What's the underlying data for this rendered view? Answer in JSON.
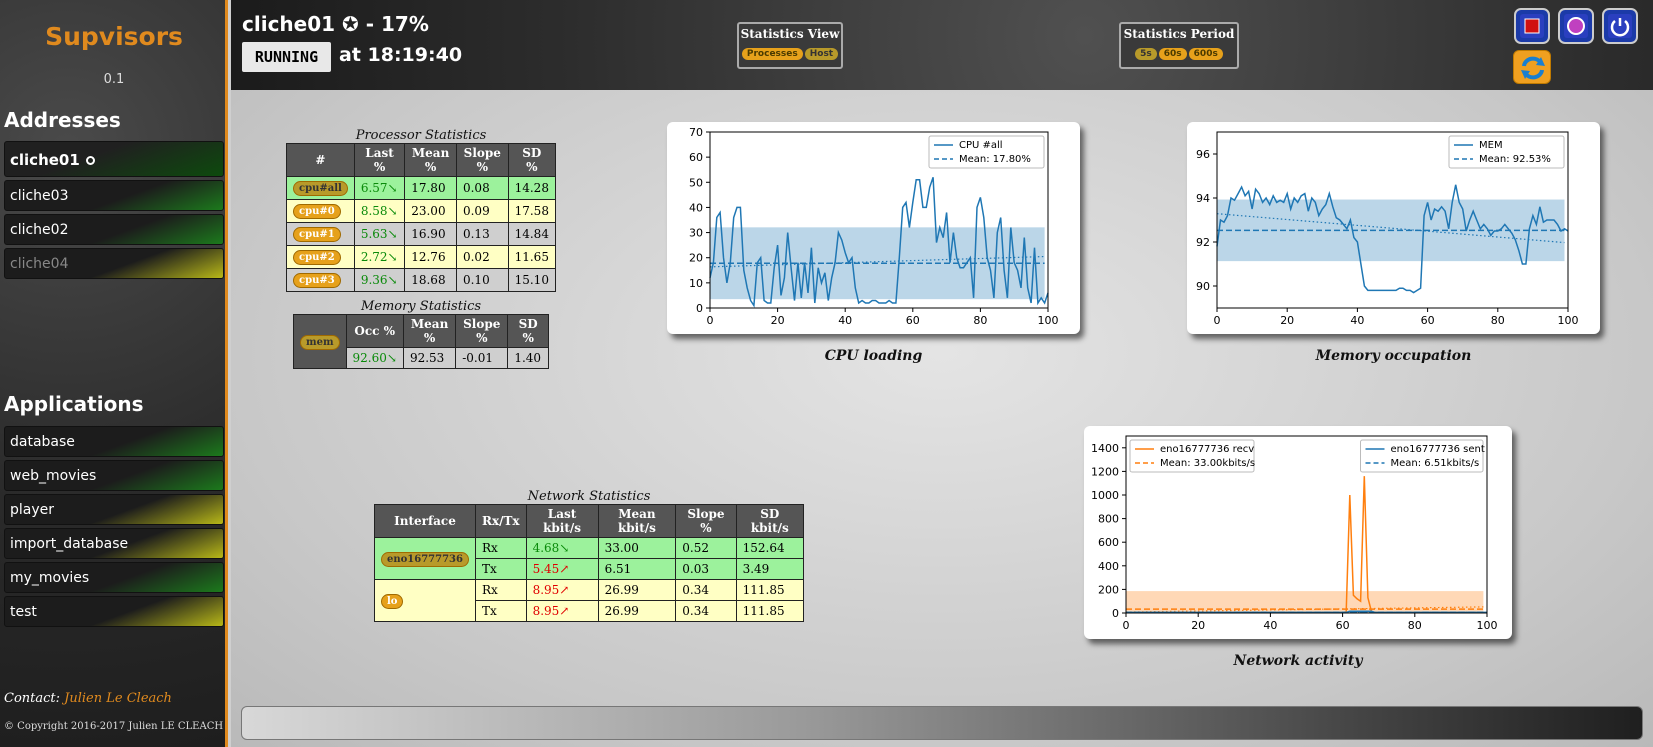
{
  "sidebar": {
    "brand": "Supvisors",
    "version": "0.1",
    "addresses_heading": "Addresses",
    "addresses": [
      {
        "label": "cliche01",
        "state": "active"
      },
      {
        "label": "cliche03",
        "state": "ok"
      },
      {
        "label": "cliche02",
        "state": "ok"
      },
      {
        "label": "cliche04",
        "state": "off"
      }
    ],
    "applications_heading": "Applications",
    "applications": [
      {
        "label": "database",
        "state": "ok"
      },
      {
        "label": "web_movies",
        "state": "ok"
      },
      {
        "label": "player",
        "state": "warn"
      },
      {
        "label": "import_database",
        "state": "warn"
      },
      {
        "label": "my_movies",
        "state": "ok"
      },
      {
        "label": "test",
        "state": "warn"
      }
    ],
    "contact_label": "Contact:",
    "contact_name": "Julien Le Cleach",
    "copyright": "© Copyright 2016-2017 Julien LE CLEACH"
  },
  "header": {
    "node_title": "cliche01 ✪ - 17%",
    "state": "RUNNING",
    "state_time": "at 18:19:40",
    "view_caption": "Statistics View",
    "view_options": [
      "Processes",
      "Host"
    ],
    "period_caption": "Statistics Period",
    "period_options": [
      "5s",
      "60s",
      "600s"
    ]
  },
  "processor": {
    "caption": "Processor Statistics",
    "headers": [
      "#",
      "Last %",
      "Mean %",
      "Slope %",
      "SD %"
    ],
    "rows": [
      {
        "cpu": "cpu#all",
        "last": "6.57↘",
        "mean": "17.80",
        "slope": "0.08",
        "sd": "14.28",
        "style": "green"
      },
      {
        "cpu": "cpu#0",
        "last": "8.58↘",
        "mean": "23.00",
        "slope": "0.09",
        "sd": "17.58",
        "style": "yellow"
      },
      {
        "cpu": "cpu#1",
        "last": "5.63↘",
        "mean": "16.90",
        "slope": "0.13",
        "sd": "14.84",
        "style": "grey"
      },
      {
        "cpu": "cpu#2",
        "last": "2.72↘",
        "mean": "12.76",
        "slope": "0.02",
        "sd": "11.65",
        "style": "yellow"
      },
      {
        "cpu": "cpu#3",
        "last": "9.36↘",
        "mean": "18.68",
        "slope": "0.10",
        "sd": "15.10",
        "style": "grey"
      }
    ]
  },
  "memory": {
    "caption": "Memory Statistics",
    "headers": [
      "Occ %",
      "Mean %",
      "Slope %",
      "SD %"
    ],
    "tag": "mem",
    "row": {
      "occ": "92.60↘",
      "mean": "92.53",
      "slope": "-0.01",
      "sd": "1.40"
    }
  },
  "network": {
    "caption": "Network Statistics",
    "headers": [
      "Interface",
      "Rx/Tx",
      "Last kbit/s",
      "Mean kbit/s",
      "Slope %",
      "SD kbit/s"
    ],
    "interfaces": [
      {
        "name": "eno16777736",
        "style": "green",
        "rows": [
          {
            "dir": "Rx",
            "last": "4.68↘",
            "last_color": "g",
            "mean": "33.00",
            "slope": "0.52",
            "sd": "152.64"
          },
          {
            "dir": "Tx",
            "last": "5.45↗",
            "last_color": "r",
            "mean": "6.51",
            "slope": "0.03",
            "sd": "3.49"
          }
        ]
      },
      {
        "name": "lo",
        "style": "yellow",
        "rows": [
          {
            "dir": "Rx",
            "last": "8.95↗",
            "last_color": "r",
            "mean": "26.99",
            "slope": "0.34",
            "sd": "111.85"
          },
          {
            "dir": "Tx",
            "last": "8.95↗",
            "last_color": "r",
            "mean": "26.99",
            "slope": "0.34",
            "sd": "111.85"
          }
        ]
      }
    ]
  },
  "chart_data": [
    {
      "type": "line",
      "title": "CPU loading",
      "x_range": [
        0,
        100
      ],
      "ylim": [
        0,
        70
      ],
      "xticks": [
        0,
        20,
        40,
        60,
        80,
        100
      ],
      "yticks": [
        0,
        10,
        20,
        30,
        40,
        50,
        60,
        70
      ],
      "legend": [
        "CPU #all",
        "Mean: 17.80%"
      ],
      "legend_position": "top-right",
      "mean": 17.8,
      "sd": 14.28,
      "color": "#1f77b4",
      "series": [
        {
          "name": "CPU #all",
          "values": [
            12,
            18,
            36,
            38,
            20,
            10,
            18,
            36,
            40,
            40,
            15,
            8,
            3,
            1,
            18,
            20,
            3,
            2,
            2,
            16,
            25,
            5,
            12,
            30,
            16,
            3,
            18,
            4,
            18,
            6,
            24,
            2,
            16,
            10,
            14,
            3,
            12,
            18,
            30,
            27,
            22,
            18,
            20,
            8,
            2,
            3,
            2,
            2,
            3,
            3,
            2,
            2,
            2,
            3,
            2,
            2,
            20,
            40,
            42,
            32,
            42,
            51,
            51,
            40,
            40,
            48,
            52,
            26,
            32,
            28,
            38,
            18,
            30,
            20,
            16,
            16,
            18,
            20,
            4,
            40,
            44,
            36,
            20,
            15,
            4,
            30,
            36,
            15,
            4,
            32,
            18,
            15,
            8,
            28,
            8,
            2,
            24,
            2,
            4,
            2,
            6
          ]
        }
      ]
    },
    {
      "type": "line",
      "title": "Memory occupation",
      "x_range": [
        0,
        100
      ],
      "ylim": [
        89,
        97
      ],
      "xticks": [
        0,
        20,
        40,
        60,
        80,
        100
      ],
      "yticks": [
        90,
        92,
        94,
        96
      ],
      "legend": [
        "MEM",
        "Mean: 92.53%"
      ],
      "legend_position": "top-right",
      "mean": 92.53,
      "sd": 1.4,
      "color": "#1f77b4",
      "series": [
        {
          "name": "MEM",
          "values": [
            91.8,
            93.0,
            92.9,
            93.2,
            94.0,
            93.9,
            94.2,
            94.5,
            94.1,
            94.3,
            93.5,
            94.4,
            94.2,
            93.8,
            94.0,
            93.7,
            94.1,
            93.8,
            93.9,
            93.8,
            94.2,
            93.5,
            94.0,
            93.8,
            94.1,
            94.2,
            93.4,
            94.0,
            93.8,
            93.2,
            93.5,
            93.7,
            94.2,
            93.6,
            93.1,
            93.0,
            92.8,
            92.6,
            93.0,
            92.2,
            92.0,
            91.0,
            90.0,
            89.8,
            89.8,
            89.8,
            89.8,
            89.8,
            89.8,
            89.8,
            89.8,
            89.8,
            89.9,
            89.9,
            89.8,
            89.8,
            89.7,
            89.8,
            89.9,
            93.2,
            93.8,
            93.0,
            93.5,
            93.4,
            93.6,
            93.4,
            92.6,
            93.8,
            94.6,
            93.8,
            93.5,
            92.5,
            93.0,
            93.4,
            93.0,
            92.6,
            92.8,
            92.6,
            92.3,
            92.5,
            92.5,
            92.6,
            92.8,
            92.6,
            92.4,
            92.1,
            91.6,
            91.0,
            91.0,
            92.6,
            93.2,
            92.8,
            93.6,
            92.9,
            93.0,
            93.0,
            93.0,
            92.8,
            92.5,
            92.6,
            92.5
          ]
        }
      ]
    },
    {
      "type": "line",
      "title": "Network activity",
      "x_range": [
        0,
        100
      ],
      "ylim": [
        0,
        1500
      ],
      "xticks": [
        0,
        20,
        40,
        60,
        80,
        100
      ],
      "yticks": [
        0,
        200,
        400,
        600,
        800,
        1000,
        1200,
        1400
      ],
      "legend_left": [
        "eno16777736 recv",
        "Mean: 33.00kbits/s"
      ],
      "legend_right": [
        "eno16777736 sent",
        "Mean: 6.51kbits/s"
      ],
      "series": [
        {
          "name": "eno16777736 recv",
          "color": "#ff7f0e",
          "mean": 33.0,
          "sd": 152.64,
          "values": [
            4,
            4,
            4,
            4,
            4,
            4,
            4,
            4,
            4,
            4,
            4,
            4,
            4,
            4,
            4,
            4,
            4,
            4,
            4,
            4,
            4,
            4,
            4,
            4,
            4,
            4,
            4,
            4,
            4,
            4,
            4,
            4,
            4,
            4,
            4,
            4,
            4,
            4,
            4,
            4,
            4,
            4,
            4,
            4,
            4,
            4,
            4,
            4,
            4,
            4,
            4,
            4,
            4,
            4,
            4,
            4,
            4,
            4,
            4,
            4,
            4,
            10,
            1000,
            150,
            120,
            100,
            1160,
            130,
            10,
            4,
            4,
            4,
            4,
            4,
            4,
            4,
            4,
            4,
            4,
            4,
            4,
            4,
            4,
            4,
            4,
            4,
            4,
            4,
            4,
            4,
            4,
            4,
            4,
            4,
            4,
            4,
            4,
            4,
            4,
            4,
            4
          ]
        },
        {
          "name": "eno16777736 sent",
          "color": "#1f77b4",
          "mean": 6.51,
          "sd": 3.49,
          "values": [
            5,
            5,
            5,
            5,
            5,
            5,
            5,
            5,
            5,
            5,
            5,
            5,
            5,
            5,
            5,
            5,
            5,
            5,
            5,
            5,
            5,
            5,
            5,
            5,
            5,
            5,
            5,
            5,
            5,
            5,
            5,
            5,
            5,
            5,
            5,
            5,
            5,
            5,
            5,
            5,
            5,
            5,
            5,
            5,
            5,
            5,
            5,
            5,
            5,
            5,
            5,
            5,
            5,
            5,
            5,
            5,
            5,
            5,
            5,
            5,
            5,
            5,
            15,
            15,
            15,
            15,
            15,
            15,
            15,
            5,
            5,
            5,
            5,
            5,
            5,
            5,
            5,
            5,
            5,
            5,
            5,
            5,
            5,
            5,
            5,
            5,
            5,
            5,
            5,
            5,
            5,
            5,
            5,
            5,
            5,
            5,
            5,
            5,
            5,
            5,
            5
          ]
        }
      ]
    }
  ]
}
